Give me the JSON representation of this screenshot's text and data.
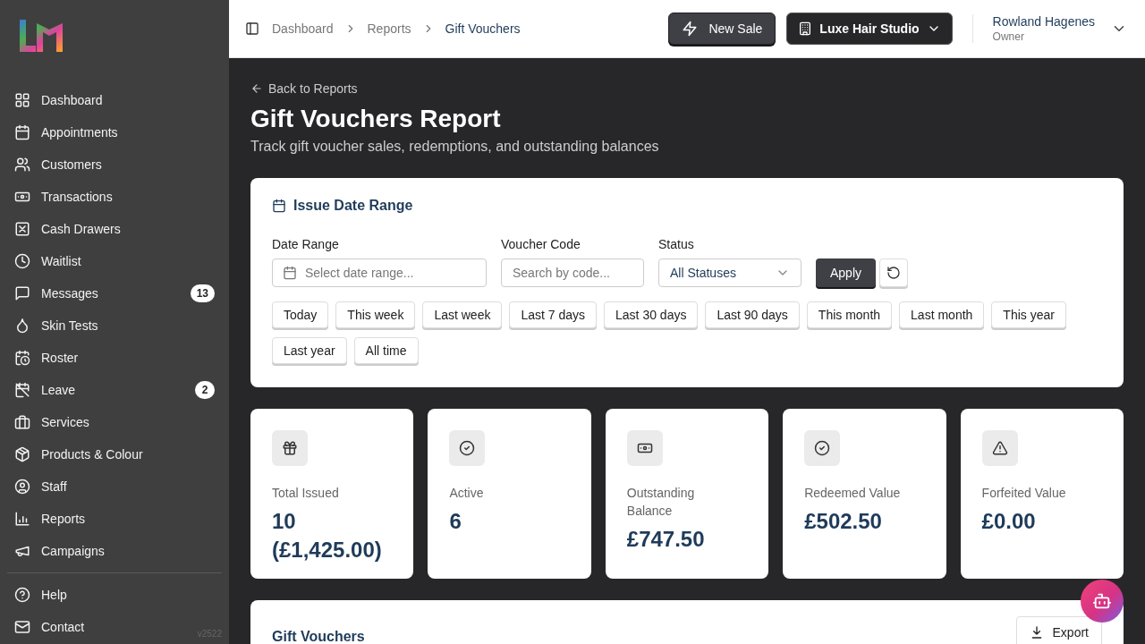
{
  "sidebar": {
    "items": [
      {
        "label": "Dashboard"
      },
      {
        "label": "Appointments"
      },
      {
        "label": "Customers"
      },
      {
        "label": "Transactions"
      },
      {
        "label": "Cash Drawers"
      },
      {
        "label": "Waitlist"
      },
      {
        "label": "Messages",
        "badge": "13"
      },
      {
        "label": "Skin Tests"
      },
      {
        "label": "Roster"
      },
      {
        "label": "Leave",
        "badge": "2"
      },
      {
        "label": "Services"
      },
      {
        "label": "Products & Colour"
      },
      {
        "label": "Staff"
      },
      {
        "label": "Reports"
      },
      {
        "label": "Campaigns"
      }
    ],
    "footer_items": [
      {
        "label": "Help"
      },
      {
        "label": "Contact"
      }
    ],
    "version": "v2522"
  },
  "header": {
    "breadcrumbs": [
      {
        "label": "Dashboard",
        "current": false
      },
      {
        "label": "Reports",
        "current": false
      },
      {
        "label": "Gift Vouchers",
        "current": true
      }
    ],
    "new_sale": "New Sale",
    "business": "Luxe Hair Studio",
    "user": {
      "name": "Rowland Hagenes",
      "role": "Owner"
    }
  },
  "page": {
    "back_link": "Back to Reports",
    "title": "Gift Vouchers Report",
    "subtitle": "Track gift voucher sales, redemptions, and outstanding balances"
  },
  "filters": {
    "title": "Issue Date Range",
    "date_range": {
      "label": "Date Range",
      "placeholder": "Select date range..."
    },
    "voucher_code": {
      "label": "Voucher Code",
      "placeholder": "Search by code..."
    },
    "status": {
      "label": "Status",
      "value": "All Statuses"
    },
    "apply": "Apply",
    "presets": [
      "Today",
      "This week",
      "Last week",
      "Last 7 days",
      "Last 30 days",
      "Last 90 days",
      "This month",
      "Last month",
      "This year",
      "Last year",
      "All time"
    ]
  },
  "stats": [
    {
      "label": "Total Issued",
      "value": "10 (£1,425.00)"
    },
    {
      "label": "Active",
      "value": "6"
    },
    {
      "label": "Outstanding Balance",
      "value": "£747.50"
    },
    {
      "label": "Redeemed Value",
      "value": "£502.50"
    },
    {
      "label": "Forfeited Value",
      "value": "£0.00"
    }
  ],
  "vouchers_card": {
    "title": "Gift Vouchers",
    "export": "Export"
  }
}
